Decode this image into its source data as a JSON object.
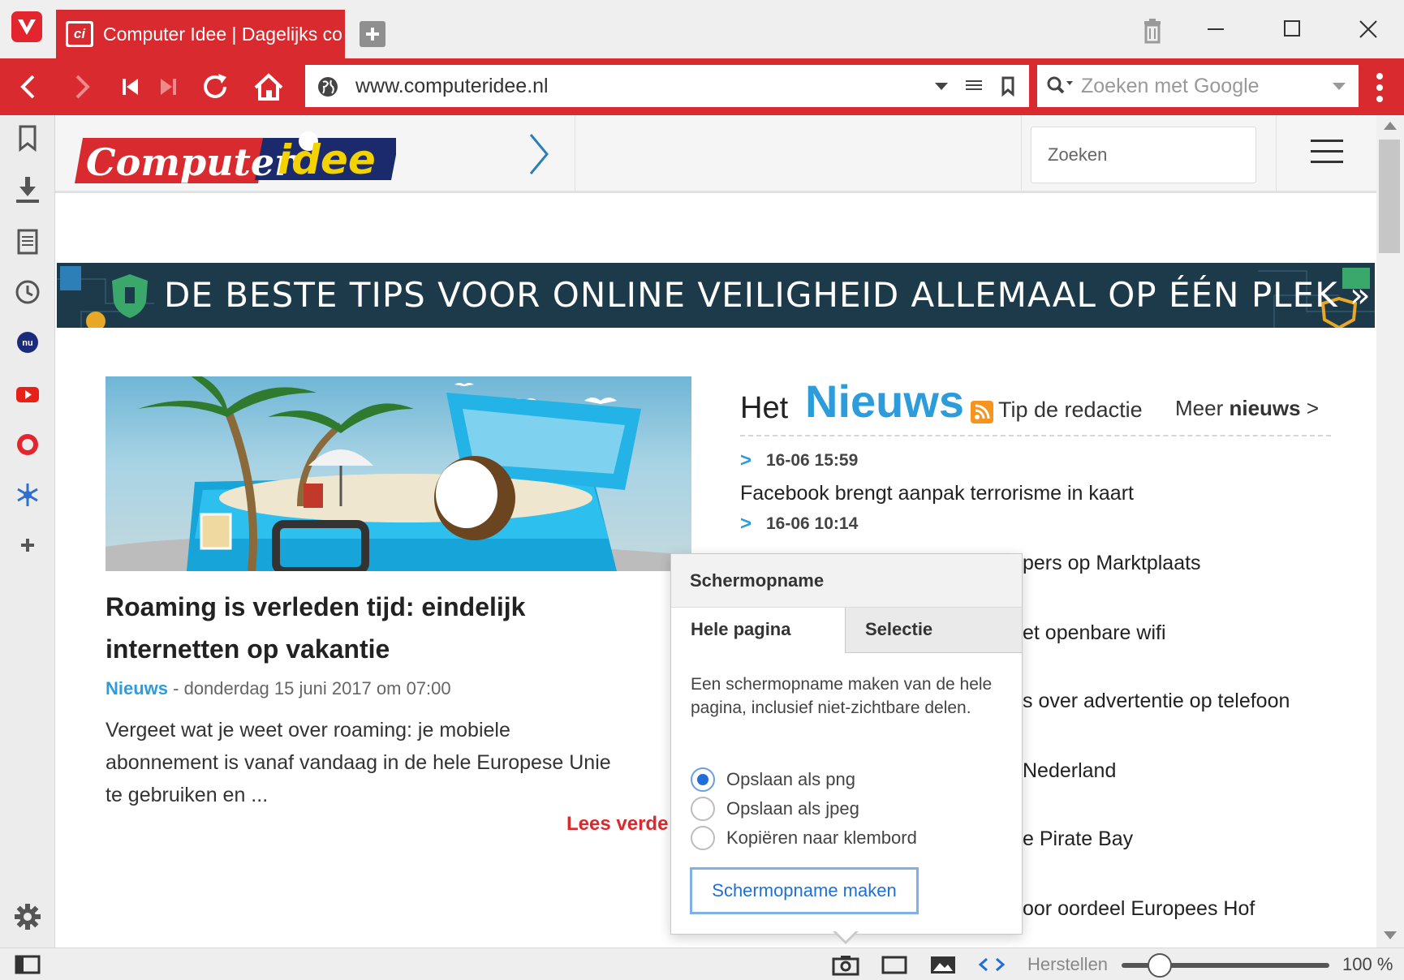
{
  "browser": {
    "tab_title": "Computer Idee | Dagelijks co",
    "favicon_text": "ci",
    "url": "www.computeridee.nl",
    "search_placeholder": "Zoeken met Google"
  },
  "site": {
    "logo_text_left": "Computer",
    "logo_text_right": "idee",
    "search_placeholder": "Zoeken",
    "banner_text": "DE BESTE TIPS VOOR ONLINE VEILIGHEID ALLEMAAL OP ÉÉN PLEK »"
  },
  "article": {
    "title": "Roaming is verleden tijd: eindelijk internetten op vakantie",
    "category": "Nieuws",
    "date": " - donderdag 15 juni 2017 om 07:00",
    "excerpt": "Vergeet wat je weet over roaming: je mobiele\nabonnement is vanaf vandaag in de hele Europese Unie\nte gebruiken en ...",
    "read_more": "Lees verde"
  },
  "news": {
    "het": "Het",
    "nieuws": "Nieuws",
    "tip": "Tip de redactie",
    "meer_prefix": "Meer ",
    "meer_bold": "nieuws",
    "meer_suffix": " >",
    "items": [
      {
        "time": "16-06 15:59",
        "title": "Facebook brengt aanpak terrorisme in kaart"
      },
      {
        "time": "16-06 10:14",
        "title": ""
      }
    ],
    "fragments": [
      "pers op Marktplaats",
      "et openbare wifi",
      "s over advertentie op telefoon",
      "Nederland",
      "e Pirate Bay",
      "oor oordeel Europees Hof"
    ]
  },
  "capture_popup": {
    "title": "Schermopname",
    "tab_full": "Hele pagina",
    "tab_selection": "Selectie",
    "description": "Een schermopname maken van de hele pagina, inclusief niet-zichtbare delen.",
    "options": [
      {
        "label": "Opslaan als png",
        "selected": true
      },
      {
        "label": "Opslaan als jpeg",
        "selected": false
      },
      {
        "label": "Kopiëren naar klembord",
        "selected": false
      }
    ],
    "button": "Schermopname maken"
  },
  "statusbar": {
    "reset": "Herstellen",
    "zoom": "100 %",
    "zoom_level_percent": 100
  },
  "colors": {
    "brand_red": "#d92b2f",
    "accent_blue": "#2d9cdb",
    "banner_bg": "#1d3a4a"
  }
}
